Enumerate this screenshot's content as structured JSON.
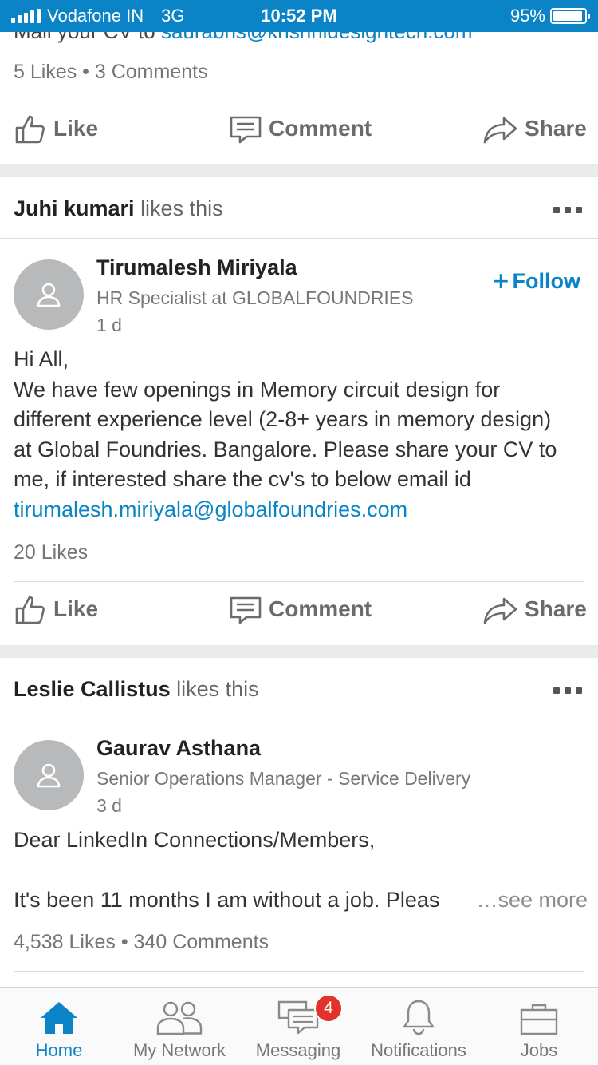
{
  "status_bar": {
    "carrier": "Vodafone IN",
    "network": "3G",
    "time": "10:52 PM",
    "battery": "95%",
    "battery_level": 0.95
  },
  "feed": {
    "prev_post": {
      "cut_text_prefix": "Mail your CV to ",
      "cut_text_link": "saurabhs@krishnidesigntech.com",
      "likes": "5 Likes",
      "comments": "3 Comments",
      "actions": {
        "like": "Like",
        "comment": "Comment",
        "share": "Share"
      }
    },
    "post1": {
      "liker_name": "Juhi kumari",
      "liker_suffix": "likes this",
      "author": "Tirumalesh Miriyala",
      "headline": "HR Specialist at GLOBALFOUNDRIES",
      "time": "1 d",
      "follow": "Follow",
      "body_lines": [
        "Hi All,",
        "We have few openings in Memory circuit design for",
        "different experience level (2-8+ years in memory design)",
        "at Global Foundries. Bangalore. Please share your CV to",
        "me, if interested share the cv's to below email id"
      ],
      "email": "tirumalesh.miriyala@globalfoundries.com",
      "likes": "20 Likes",
      "actions": {
        "like": "Like",
        "comment": "Comment",
        "share": "Share"
      }
    },
    "post2": {
      "liker_name": "Leslie Callistus",
      "liker_suffix": "likes this",
      "author": "Gaurav Asthana",
      "headline": "Senior Operations Manager - Service Delivery",
      "time": "3 d",
      "body_line1": "Dear LinkedIn Connections/Members,",
      "body_line2": "It's been 11 months I am without a job. Pleas",
      "see_more": "…see more",
      "likes": "4,538 Likes",
      "comments": "340 Comments"
    }
  },
  "bottom_nav": {
    "items": [
      {
        "label": "Home",
        "icon": "home-icon",
        "active": true
      },
      {
        "label": "My Network",
        "icon": "network-icon"
      },
      {
        "label": "Messaging",
        "icon": "messaging-icon",
        "badge": "4"
      },
      {
        "label": "Notifications",
        "icon": "bell-icon"
      },
      {
        "label": "Jobs",
        "icon": "briefcase-icon"
      }
    ]
  },
  "colors": {
    "accent": "#0a84c6",
    "badge": "#e2322a",
    "separator": "#e8eaec"
  }
}
